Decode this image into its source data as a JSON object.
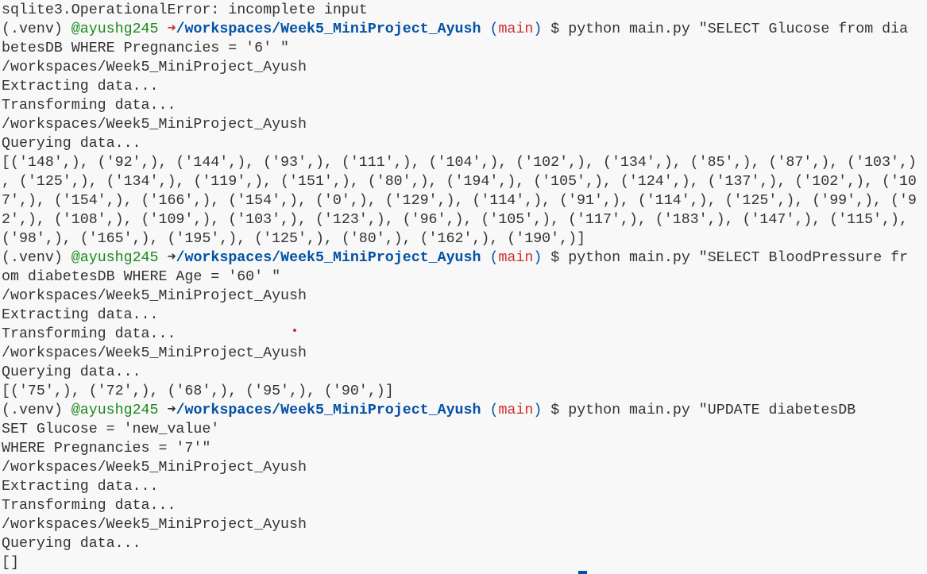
{
  "terminal": {
    "lines": [
      {
        "text": "sqlite3.OperationalError: incomplete input"
      },
      {
        "prompt": {
          "venv": "(.venv)",
          "user": "@ayushg245",
          "arrow": "➜",
          "arrow_error": true,
          "path": "/workspaces/Week5_MiniProject_Ayush",
          "branch_open": "(",
          "branch": "main",
          "branch_close": ")",
          "cmd": " $ python main.py \"SELECT Glucose from dia"
        }
      },
      {
        "text": "betesDB WHERE Pregnancies = '6' \""
      },
      {
        "text": "/workspaces/Week5_MiniProject_Ayush"
      },
      {
        "text": "Extracting data..."
      },
      {
        "text": "Transforming data..."
      },
      {
        "text": "/workspaces/Week5_MiniProject_Ayush"
      },
      {
        "text": "Querying data..."
      },
      {
        "text": "[('148',), ('92',), ('144',), ('93',), ('111',), ('104',), ('102',), ('134',), ('85',), ('87',), ('103',)"
      },
      {
        "text": ", ('125',), ('134',), ('119',), ('151',), ('80',), ('194',), ('105',), ('124',), ('137',), ('102',), ('10"
      },
      {
        "text": "7',), ('154',), ('166',), ('154',), ('0',), ('129',), ('114',), ('91',), ('114',), ('125',), ('99',), ('9"
      },
      {
        "text": "2',), ('108',), ('109',), ('103',), ('123',), ('96',), ('105',), ('117',), ('183',), ('147',), ('115',),"
      },
      {
        "text": "('98',), ('165',), ('195',), ('125',), ('80',), ('162',), ('190',)]"
      },
      {
        "prompt": {
          "venv": "(.venv)",
          "user": "@ayushg245",
          "arrow": "➜",
          "arrow_error": false,
          "path": "/workspaces/Week5_MiniProject_Ayush",
          "branch_open": "(",
          "branch": "main",
          "branch_close": ")",
          "cmd": " $ python main.py \"SELECT BloodPressure fr"
        }
      },
      {
        "text": "om diabetesDB WHERE Age = '60' \""
      },
      {
        "text": "/workspaces/Week5_MiniProject_Ayush"
      },
      {
        "text": "Extracting data..."
      },
      {
        "text": "Transforming data..."
      },
      {
        "text": "/workspaces/Week5_MiniProject_Ayush"
      },
      {
        "text": "Querying data..."
      },
      {
        "text": "[('75',), ('72',), ('68',), ('95',), ('90',)]"
      },
      {
        "prompt": {
          "venv": "(.venv)",
          "user": "@ayushg245",
          "arrow": "➜",
          "arrow_error": false,
          "path": "/workspaces/Week5_MiniProject_Ayush",
          "branch_open": "(",
          "branch": "main",
          "branch_close": ")",
          "cmd": " $ python main.py \"UPDATE diabetesDB"
        }
      },
      {
        "text": "SET Glucose = 'new_value'"
      },
      {
        "text": "WHERE Pregnancies = '7'\""
      },
      {
        "text": "/workspaces/Week5_MiniProject_Ayush"
      },
      {
        "text": "Extracting data..."
      },
      {
        "text": "Transforming data..."
      },
      {
        "text": "/workspaces/Week5_MiniProject_Ayush"
      },
      {
        "text": "Querying data..."
      },
      {
        "text": "[]"
      }
    ]
  },
  "colors": {
    "background": "#f8f8f8",
    "text": "#333333",
    "user": "#1a8a1a",
    "path": "#0451a5",
    "error": "#cd3131"
  }
}
